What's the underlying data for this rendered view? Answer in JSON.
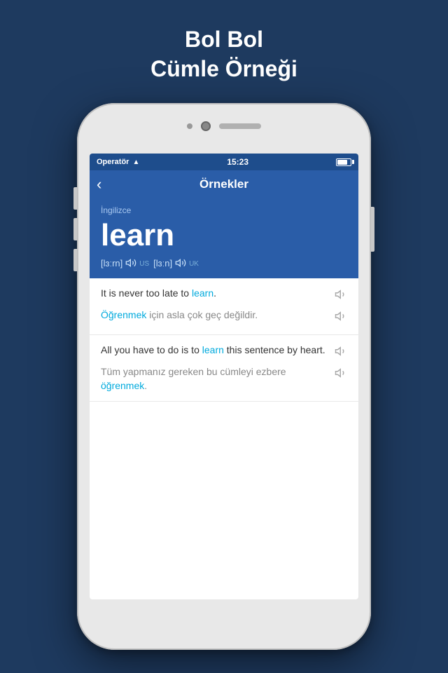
{
  "page": {
    "title_line1": "Bol Bol",
    "title_line2": "Cümle Örneği"
  },
  "status_bar": {
    "operator": "Operatör",
    "time": "15:23"
  },
  "nav": {
    "back_label": "‹",
    "title": "Örnekler"
  },
  "word_section": {
    "language": "İngilizce",
    "word": "learn",
    "phonetic_us": "[lɜːrn]",
    "phonetic_us_label": "US",
    "phonetic_uk": "[lɜːn]",
    "phonetic_uk_label": "UK"
  },
  "sentences": [
    {
      "en_before": "It is never too late to ",
      "en_highlight": "learn",
      "en_after": ".",
      "tr_highlight": "Öğrenmek",
      "tr_after": " için asla çok geç değildir."
    },
    {
      "en_before": "All you have to do is to ",
      "en_highlight": "learn",
      "en_after": " this sentence by heart.",
      "tr_before": "Tüm yapmanız gereken bu cümleyi ezbere ",
      "tr_highlight": "öğrenmek",
      "tr_after": "."
    }
  ]
}
